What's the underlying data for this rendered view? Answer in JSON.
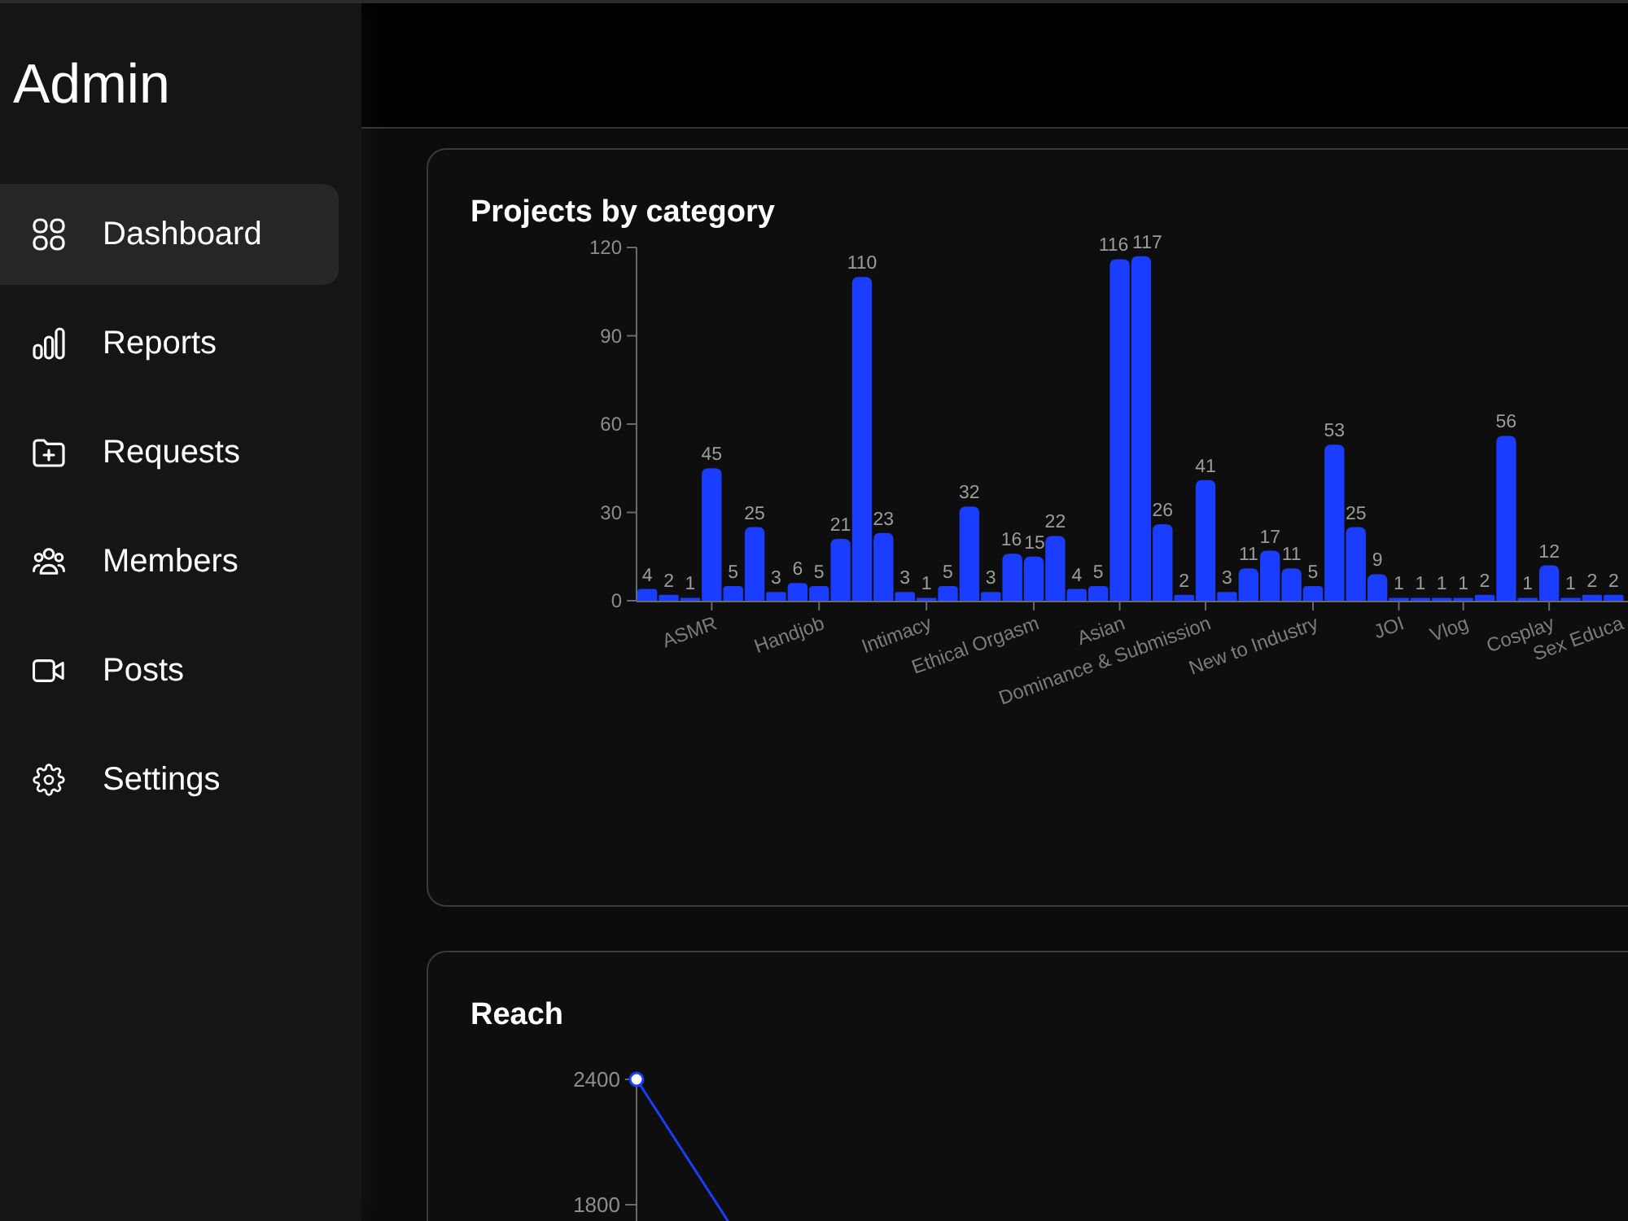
{
  "sidebar": {
    "title": "Admin",
    "items": [
      {
        "label": "Dashboard",
        "selected": true
      },
      {
        "label": "Reports",
        "selected": false
      },
      {
        "label": "Requests",
        "selected": false
      },
      {
        "label": "Members",
        "selected": false
      },
      {
        "label": "Posts",
        "selected": false
      },
      {
        "label": "Settings",
        "selected": false
      }
    ]
  },
  "projects_by_category": {
    "chart_data": {
      "type": "bar",
      "title": "Projects by category",
      "categories": [
        null,
        null,
        null,
        "ASMR",
        null,
        null,
        null,
        null,
        "Handjob",
        null,
        null,
        null,
        null,
        "Intimacy",
        null,
        null,
        null,
        null,
        "Ethical Orgasm",
        null,
        null,
        null,
        "Asian",
        null,
        null,
        null,
        "Dominance & Submission",
        null,
        null,
        null,
        null,
        "New to Industry",
        null,
        null,
        null,
        "JOI",
        null,
        null,
        "Vlog",
        null,
        null,
        null,
        "Cosplay",
        null,
        null,
        null,
        "Sex Educa"
      ],
      "series": [
        {
          "color": "#1b3dff",
          "values": [
            4,
            2,
            1,
            45,
            5,
            25,
            3,
            6,
            5,
            21,
            110,
            23,
            3,
            1,
            5,
            32,
            3,
            16,
            15,
            22,
            4,
            5,
            116,
            117,
            26,
            2,
            41,
            3,
            11,
            17,
            11,
            5,
            53,
            25,
            9,
            1,
            1,
            1,
            1,
            2,
            56,
            1,
            12,
            1,
            2,
            2,
            null
          ]
        }
      ],
      "ylim": [
        0,
        120
      ],
      "yticks": [
        0,
        30,
        60,
        90,
        120
      ],
      "data_labels": true
    }
  },
  "reach": {
    "title": "Reach",
    "y_axis_labels": [
      "2400",
      "1800"
    ]
  }
}
